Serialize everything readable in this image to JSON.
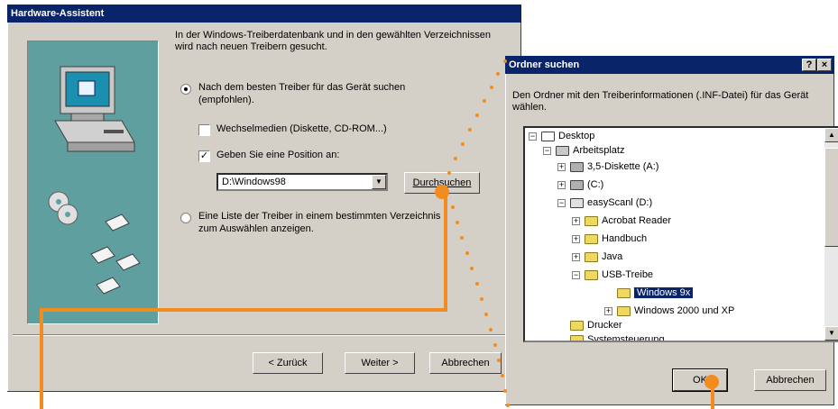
{
  "wizard": {
    "title": "Hardware-Assistent",
    "description": "In der Windows-Treiberdatenbank und in den gewählten Verzeichnissen wird nach neuen Treibern gesucht.",
    "option_best_line1": "Nach dem besten Treiber für das Gerät suchen",
    "option_best_line2": "(empfohlen).",
    "check_media": "Wechselmedien (Diskette, CD-ROM...)",
    "check_position": "Geben Sie eine Position an:",
    "path_value": "D:\\Windows98",
    "browse_label": "Durchsuchen",
    "option_list_line1": "Eine Liste der Treiber in einem bestimmten Verzeichnis",
    "option_list_line2": "zum Auswählen anzeigen.",
    "back_label": "< Zurück",
    "next_label": "Weiter >",
    "cancel_label": "Abbrechen"
  },
  "folder_dialog": {
    "title": "Ordner suchen",
    "help_label": "?",
    "close_label": "×",
    "description": "Den Ordner mit den Treiberinformationen (.INF-Datei) für das Gerät wählen.",
    "tree": [
      {
        "label": "Desktop"
      },
      {
        "label": "Arbeitsplatz"
      },
      {
        "label": "3,5-Diskette (A:)"
      },
      {
        "label": "(C:)"
      },
      {
        "label": "easyScanl (D:)"
      },
      {
        "label": "Acrobat Reader"
      },
      {
        "label": "Handbuch"
      },
      {
        "label": "Java"
      },
      {
        "label": "USB-Treibe"
      },
      {
        "label": "Windows 9x"
      },
      {
        "label": "Windows 2000 und XP"
      },
      {
        "label": "Drucker"
      },
      {
        "label": "Systemsteuerung"
      }
    ],
    "ok_label": "OK",
    "cancel_label": "Abbrechen"
  },
  "colors": {
    "title_bar": "#0a246a",
    "dialog_face": "#d4d0c8",
    "selection": "#0a246a",
    "callout": "#f28c1e"
  }
}
